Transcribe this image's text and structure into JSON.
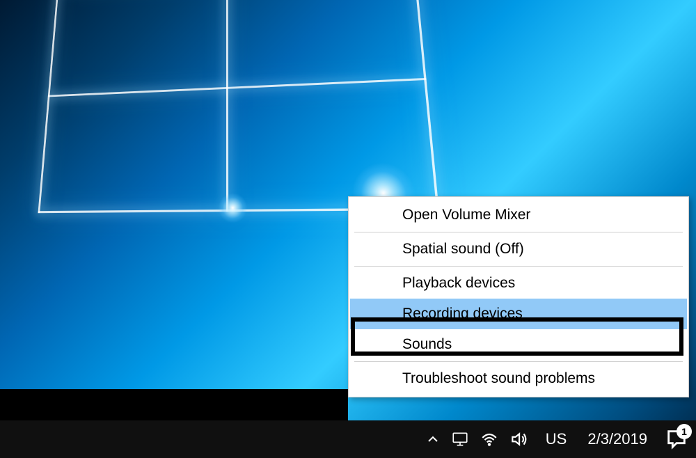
{
  "context_menu": {
    "items": [
      {
        "label": "Open Volume Mixer",
        "hovered": false,
        "separator_after": true
      },
      {
        "label": "Spatial sound (Off)",
        "hovered": false,
        "separator_after": true
      },
      {
        "label": "Playback devices",
        "hovered": false,
        "separator_after": false
      },
      {
        "label": "Recording devices",
        "hovered": true,
        "separator_after": false
      },
      {
        "label": "Sounds",
        "hovered": false,
        "separator_after": true
      },
      {
        "label": "Troubleshoot sound problems",
        "hovered": false,
        "separator_after": false
      }
    ]
  },
  "taskbar": {
    "language": "US",
    "date": "2/3/2019",
    "notification_count": "1"
  }
}
